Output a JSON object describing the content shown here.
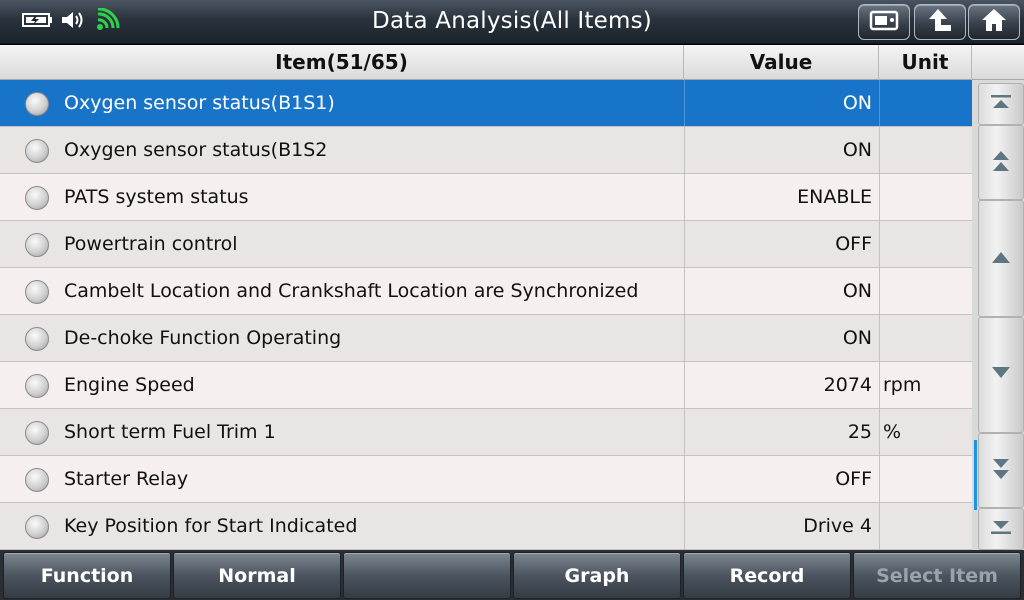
{
  "title": "Data Analysis(All Items)",
  "status_icons": [
    "battery-icon",
    "speaker-icon",
    "wifi-icon"
  ],
  "header_buttons": [
    "screenshot-icon",
    "back-icon",
    "home-icon"
  ],
  "table": {
    "col_item": "Item(51/65)",
    "col_value": "Value",
    "col_unit": "Unit",
    "rows": [
      {
        "name": "Oxygen sensor status(B1S1)",
        "value": "ON",
        "unit": ""
      },
      {
        "name": "Oxygen sensor status(B1S2",
        "value": "ON",
        "unit": ""
      },
      {
        "name": "PATS system status",
        "value": "ENABLE",
        "unit": ""
      },
      {
        "name": "Powertrain control",
        "value": "OFF",
        "unit": ""
      },
      {
        "name": "Cambelt Location and Crankshaft Location are Synchronized",
        "value": "ON",
        "unit": ""
      },
      {
        "name": "De-choke Function Operating",
        "value": "ON",
        "unit": ""
      },
      {
        "name": "Engine Speed",
        "value": "2074",
        "unit": "rpm"
      },
      {
        "name": "Short term Fuel Trim 1",
        "value": "25",
        "unit": "%"
      },
      {
        "name": "Starter Relay",
        "value": "OFF",
        "unit": ""
      },
      {
        "name": "Key Position for Start Indicated",
        "value": "Drive 4",
        "unit": ""
      }
    ]
  },
  "scroll_buttons": [
    "scroll-top-icon",
    "page-up-icon",
    "up-icon",
    "down-icon",
    "page-down-icon",
    "scroll-bottom-icon"
  ],
  "bottom_buttons": [
    {
      "label": "Function"
    },
    {
      "label": "Normal"
    },
    {
      "label": ""
    },
    {
      "label": "Graph"
    },
    {
      "label": "Record"
    },
    {
      "label": "Select Item"
    }
  ],
  "colors": {
    "selected_row": "#1874c9",
    "scroll_indicator": "#1a93e6"
  }
}
